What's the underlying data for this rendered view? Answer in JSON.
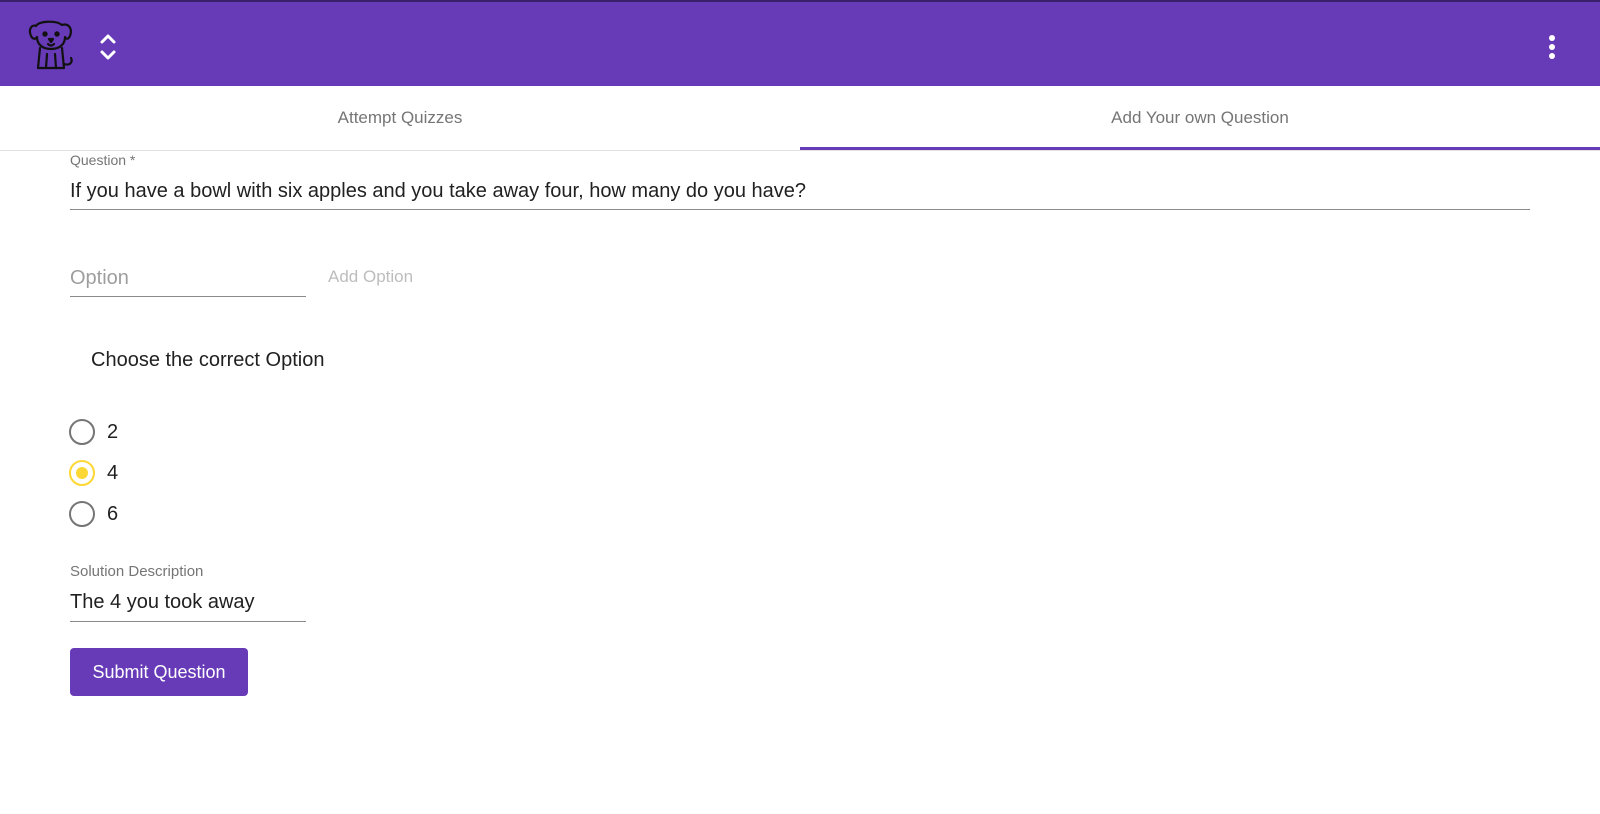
{
  "header": {
    "logo_icon": "puppy-logo-icon",
    "switcher_icon": "unfold-more-icon",
    "menu_icon": "more-vert-icon",
    "background_color": "#673ab7"
  },
  "tabs": [
    {
      "label": "Attempt Quizzes",
      "active": false
    },
    {
      "label": "Add Your own Question",
      "active": true
    }
  ],
  "form": {
    "question_label": "Question *",
    "question_value": "If you have a bowl with six apples and you take away four, how many do you have?",
    "option_placeholder": "Option",
    "option_value": "",
    "add_option_label": "Add Option",
    "choose_label": "Choose the correct Option",
    "options": [
      {
        "label": "2",
        "selected": false
      },
      {
        "label": "4",
        "selected": true
      },
      {
        "label": "6",
        "selected": false
      }
    ],
    "solution_label": "Solution Description",
    "solution_value": "The 4 you took away",
    "submit_label": "Submit Question"
  },
  "colors": {
    "primary": "#673ab7",
    "radio_selected": "#fdd835"
  }
}
